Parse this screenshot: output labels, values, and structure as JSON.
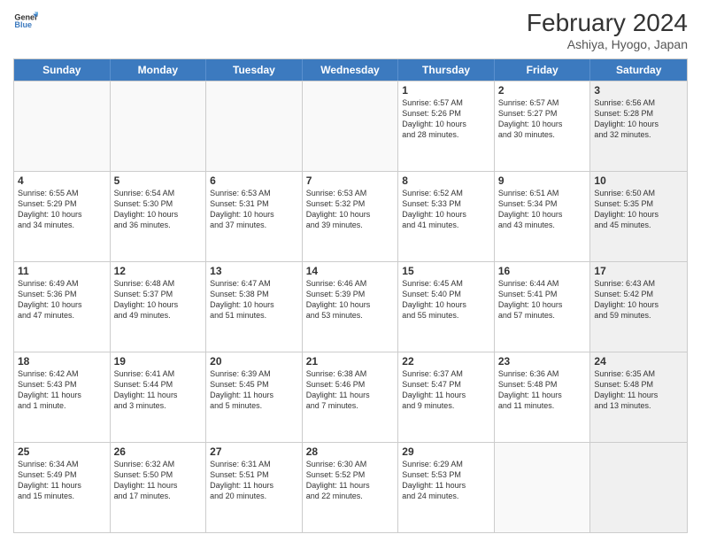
{
  "header": {
    "title": "February 2024",
    "subtitle": "Ashiya, Hyogo, Japan",
    "logo_line1": "General",
    "logo_line2": "Blue"
  },
  "days_of_week": [
    "Sunday",
    "Monday",
    "Tuesday",
    "Wednesday",
    "Thursday",
    "Friday",
    "Saturday"
  ],
  "rows": [
    [
      {
        "day": "",
        "info": "",
        "empty": true
      },
      {
        "day": "",
        "info": "",
        "empty": true
      },
      {
        "day": "",
        "info": "",
        "empty": true
      },
      {
        "day": "",
        "info": "",
        "empty": true
      },
      {
        "day": "1",
        "info": "Sunrise: 6:57 AM\nSunset: 5:26 PM\nDaylight: 10 hours\nand 28 minutes."
      },
      {
        "day": "2",
        "info": "Sunrise: 6:57 AM\nSunset: 5:27 PM\nDaylight: 10 hours\nand 30 minutes."
      },
      {
        "day": "3",
        "info": "Sunrise: 6:56 AM\nSunset: 5:28 PM\nDaylight: 10 hours\nand 32 minutes.",
        "shaded": true
      }
    ],
    [
      {
        "day": "4",
        "info": "Sunrise: 6:55 AM\nSunset: 5:29 PM\nDaylight: 10 hours\nand 34 minutes."
      },
      {
        "day": "5",
        "info": "Sunrise: 6:54 AM\nSunset: 5:30 PM\nDaylight: 10 hours\nand 36 minutes."
      },
      {
        "day": "6",
        "info": "Sunrise: 6:53 AM\nSunset: 5:31 PM\nDaylight: 10 hours\nand 37 minutes."
      },
      {
        "day": "7",
        "info": "Sunrise: 6:53 AM\nSunset: 5:32 PM\nDaylight: 10 hours\nand 39 minutes."
      },
      {
        "day": "8",
        "info": "Sunrise: 6:52 AM\nSunset: 5:33 PM\nDaylight: 10 hours\nand 41 minutes."
      },
      {
        "day": "9",
        "info": "Sunrise: 6:51 AM\nSunset: 5:34 PM\nDaylight: 10 hours\nand 43 minutes."
      },
      {
        "day": "10",
        "info": "Sunrise: 6:50 AM\nSunset: 5:35 PM\nDaylight: 10 hours\nand 45 minutes.",
        "shaded": true
      }
    ],
    [
      {
        "day": "11",
        "info": "Sunrise: 6:49 AM\nSunset: 5:36 PM\nDaylight: 10 hours\nand 47 minutes."
      },
      {
        "day": "12",
        "info": "Sunrise: 6:48 AM\nSunset: 5:37 PM\nDaylight: 10 hours\nand 49 minutes."
      },
      {
        "day": "13",
        "info": "Sunrise: 6:47 AM\nSunset: 5:38 PM\nDaylight: 10 hours\nand 51 minutes."
      },
      {
        "day": "14",
        "info": "Sunrise: 6:46 AM\nSunset: 5:39 PM\nDaylight: 10 hours\nand 53 minutes."
      },
      {
        "day": "15",
        "info": "Sunrise: 6:45 AM\nSunset: 5:40 PM\nDaylight: 10 hours\nand 55 minutes."
      },
      {
        "day": "16",
        "info": "Sunrise: 6:44 AM\nSunset: 5:41 PM\nDaylight: 10 hours\nand 57 minutes."
      },
      {
        "day": "17",
        "info": "Sunrise: 6:43 AM\nSunset: 5:42 PM\nDaylight: 10 hours\nand 59 minutes.",
        "shaded": true
      }
    ],
    [
      {
        "day": "18",
        "info": "Sunrise: 6:42 AM\nSunset: 5:43 PM\nDaylight: 11 hours\nand 1 minute."
      },
      {
        "day": "19",
        "info": "Sunrise: 6:41 AM\nSunset: 5:44 PM\nDaylight: 11 hours\nand 3 minutes."
      },
      {
        "day": "20",
        "info": "Sunrise: 6:39 AM\nSunset: 5:45 PM\nDaylight: 11 hours\nand 5 minutes."
      },
      {
        "day": "21",
        "info": "Sunrise: 6:38 AM\nSunset: 5:46 PM\nDaylight: 11 hours\nand 7 minutes."
      },
      {
        "day": "22",
        "info": "Sunrise: 6:37 AM\nSunset: 5:47 PM\nDaylight: 11 hours\nand 9 minutes."
      },
      {
        "day": "23",
        "info": "Sunrise: 6:36 AM\nSunset: 5:48 PM\nDaylight: 11 hours\nand 11 minutes."
      },
      {
        "day": "24",
        "info": "Sunrise: 6:35 AM\nSunset: 5:48 PM\nDaylight: 11 hours\nand 13 minutes.",
        "shaded": true
      }
    ],
    [
      {
        "day": "25",
        "info": "Sunrise: 6:34 AM\nSunset: 5:49 PM\nDaylight: 11 hours\nand 15 minutes."
      },
      {
        "day": "26",
        "info": "Sunrise: 6:32 AM\nSunset: 5:50 PM\nDaylight: 11 hours\nand 17 minutes."
      },
      {
        "day": "27",
        "info": "Sunrise: 6:31 AM\nSunset: 5:51 PM\nDaylight: 11 hours\nand 20 minutes."
      },
      {
        "day": "28",
        "info": "Sunrise: 6:30 AM\nSunset: 5:52 PM\nDaylight: 11 hours\nand 22 minutes."
      },
      {
        "day": "29",
        "info": "Sunrise: 6:29 AM\nSunset: 5:53 PM\nDaylight: 11 hours\nand 24 minutes."
      },
      {
        "day": "",
        "info": "",
        "empty": true
      },
      {
        "day": "",
        "info": "",
        "empty": true,
        "shaded": true
      }
    ]
  ]
}
